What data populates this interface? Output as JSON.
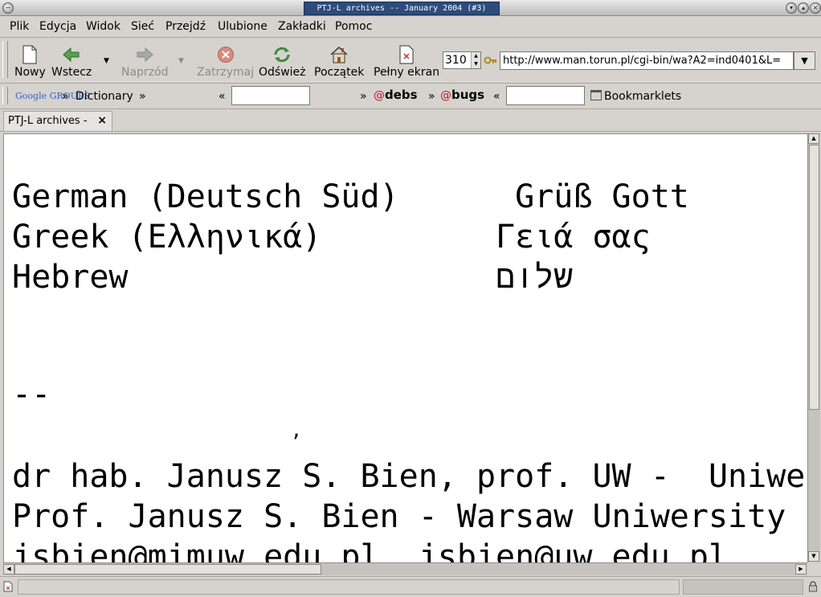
{
  "window": {
    "title": "PTJ-L archives -- January 2004 (#3)"
  },
  "menu": [
    "Plik",
    "Edycja",
    "Widok",
    "Sieć",
    "Przejdź",
    "Ulubione",
    "Zakładki",
    "Pomoc"
  ],
  "toolbar": {
    "new": "Nowy",
    "back": "Wstecz",
    "forward": "Naprzód",
    "stop": "Zatrzymaj",
    "reload": "Odśwież",
    "home": "Początek",
    "fullscreen": "Pełny ekran",
    "zoom": "310",
    "url": "http://www.man.torun.pl/cgi-bin/wa?A2=ind0401&L="
  },
  "bookmarks": {
    "google_groups": "Google GROUPS",
    "dictionary": "Dictionary",
    "debs": "debs",
    "bugs": "bugs",
    "bookmarklets": "Bookmarklets",
    "sep_right": "»",
    "sep_left": "«"
  },
  "tab": {
    "label": "PTJ-L archives -",
    "close": "×"
  },
  "content": {
    "lines": [
      "German (Deutsch Süd)      Grüß Gott",
      "Greek (Ελληνικά)         Γειά σας",
      "Hebrew                   שלום",
      "--",
      "                        ,",
      "dr hab. Janusz S. Bien, prof. UW -  Uniwersytet Warszawski",
      "Prof. Janusz S. Bien - Warsaw Uniwersity",
      "jsbien@mimuw.edu.pl  jsbien@uw.edu.pl"
    ]
  }
}
